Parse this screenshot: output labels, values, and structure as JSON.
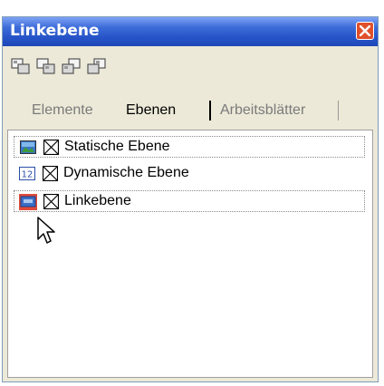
{
  "window": {
    "title": "Linkebene"
  },
  "toolbar": {
    "icons": [
      "layers-icon-1",
      "layers-icon-2",
      "layers-icon-3",
      "layers-icon-4"
    ]
  },
  "tabs": [
    {
      "label": "Elemente",
      "active": false
    },
    {
      "label": "Ebenen",
      "active": true
    },
    {
      "label": "Arbeitsblätter",
      "active": false
    }
  ],
  "layers": [
    {
      "label": "Statische Ebene",
      "icon": "image-icon",
      "checked": true
    },
    {
      "label": "Dynamische Ebene",
      "icon": "number-icon",
      "icon_text": "12",
      "checked": true
    },
    {
      "label": "Linkebene",
      "icon": "link-icon",
      "checked": true
    }
  ],
  "colors": {
    "titlebar": "#2654c8",
    "close": "#e0502a",
    "link_icon_bg": "#e04a3a",
    "panel_bg": "#ece9d8"
  }
}
